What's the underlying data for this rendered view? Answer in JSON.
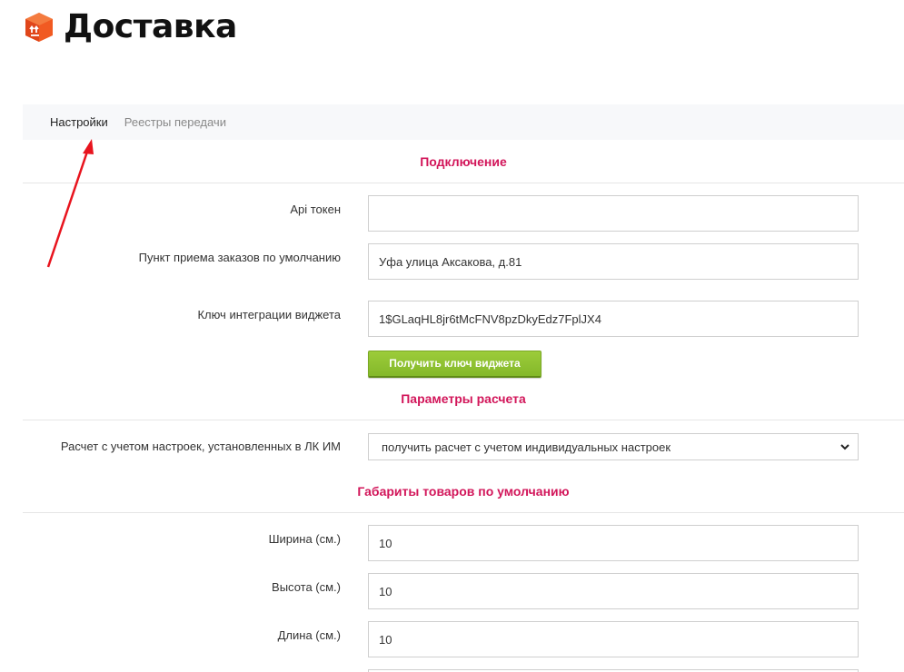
{
  "header": {
    "title": "Доставка",
    "logo_icon": "box-icon",
    "logo_color": "#f15a22"
  },
  "tabs": [
    {
      "label": "Настройки",
      "active": true
    },
    {
      "label": "Реестры передачи",
      "active": false
    }
  ],
  "sections": {
    "connection": "Подключение",
    "calc": "Параметры расчета",
    "dimensions": "Габариты товаров по умолчанию"
  },
  "fields": {
    "api_token": {
      "label": "Api токен",
      "value": ""
    },
    "pickup_point": {
      "label": "Пункт приема заказов по умолчанию",
      "value": "Уфа улица Аксакова, д.81"
    },
    "widget_key": {
      "label": "Ключ интеграции виджета",
      "value": "1$GLaqHL8jr6tMcFNV8pzDkyEdz7FplJX4"
    },
    "calc_mode": {
      "label": "Расчет с учетом настроек, установленных в ЛК ИМ",
      "value": "получить расчет с учетом индивидуальных настроек"
    },
    "width": {
      "label": "Ширина (см.)",
      "value": "10"
    },
    "height": {
      "label": "Высота (см.)",
      "value": "10"
    },
    "length": {
      "label": "Длина (см.)",
      "value": "10"
    }
  },
  "buttons": {
    "get_widget_key": "Получить ключ виджета"
  },
  "colors": {
    "accent": "#d2165a",
    "button_green": "#8dc034",
    "arrow_red": "#e8141e"
  }
}
